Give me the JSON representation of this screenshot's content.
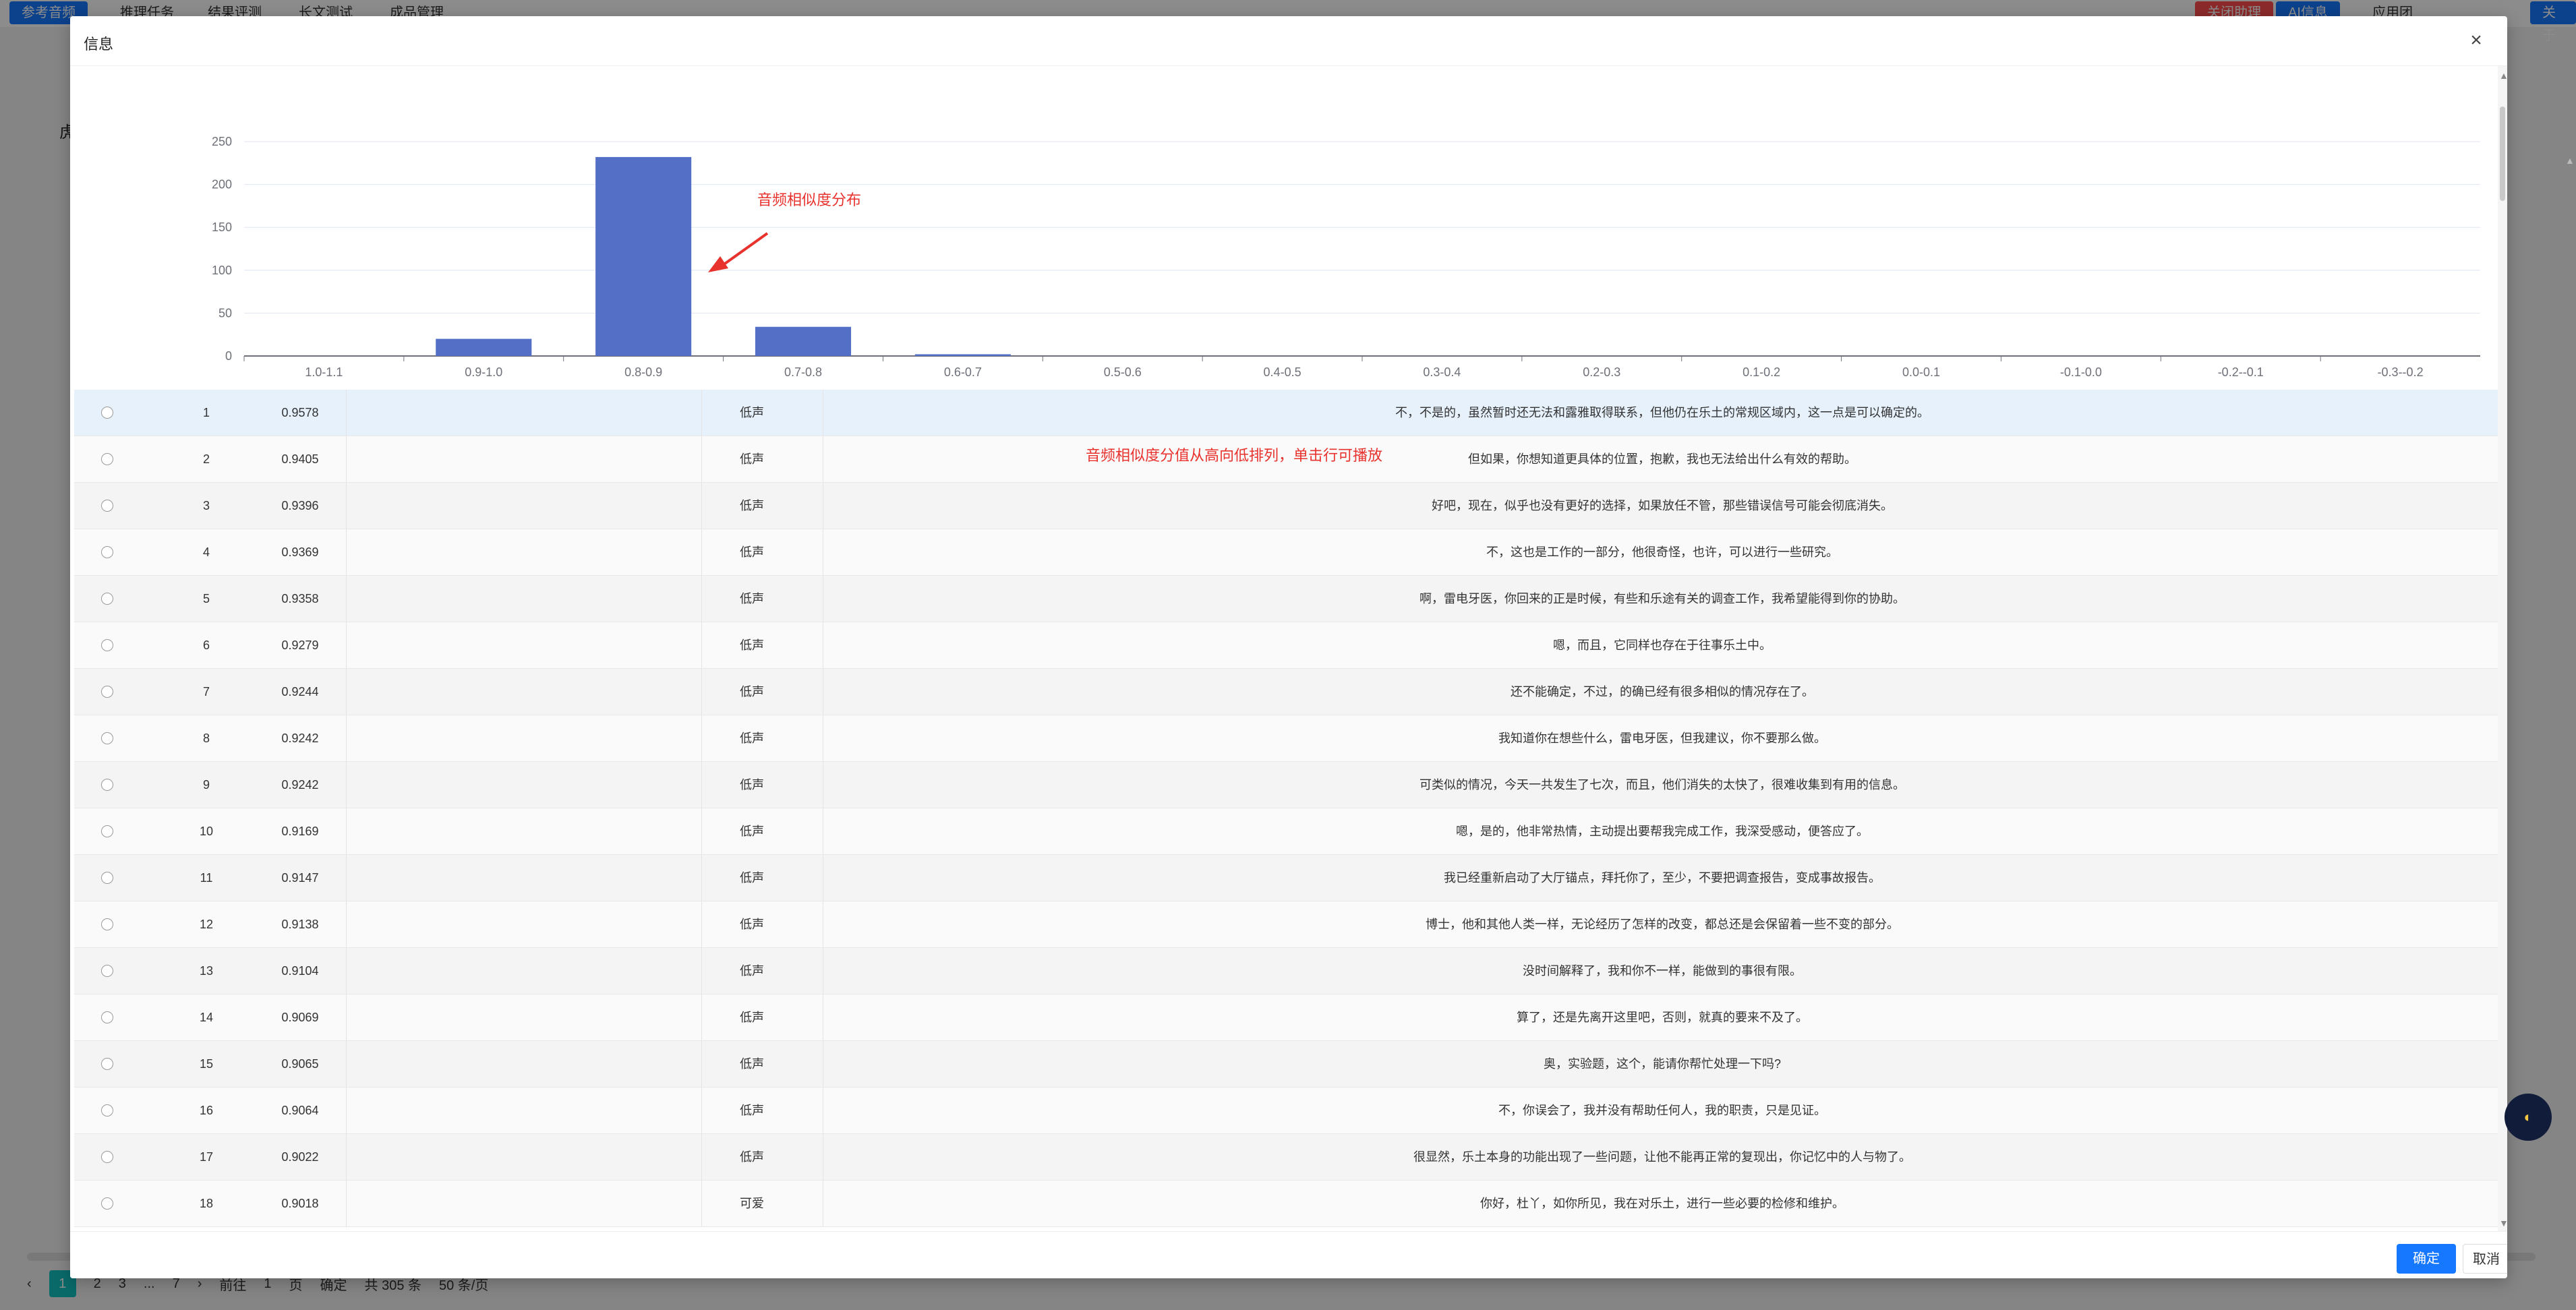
{
  "background": {
    "tabs": [
      "参考音频",
      "推理任务",
      "结果评测",
      "长文测试",
      "成品管理"
    ],
    "right_buttons": [
      "关闭助理",
      "AI信息",
      "应用团"
    ],
    "far_right": "关于",
    "side_heading": "虎",
    "pager": {
      "pages": [
        "1",
        "2",
        "3",
        "...",
        "7"
      ],
      "goto_label": "前往",
      "goto_value": "1",
      "page_suffix": "页",
      "confirm": "确定",
      "total": "共 305 条",
      "page_size": "50 条/页"
    }
  },
  "modal": {
    "title": "信息",
    "close_label": "×",
    "ok_label": "确定",
    "cancel_label": "取消"
  },
  "annotations": {
    "chart": "音频相似度分布",
    "table": "音频相似度分值从高向低排列，单击行可播放"
  },
  "chart_data": {
    "type": "bar",
    "categories": [
      "1.0-1.1",
      "0.9-1.0",
      "0.8-0.9",
      "0.7-0.8",
      "0.6-0.7",
      "0.5-0.6",
      "0.4-0.5",
      "0.3-0.4",
      "0.2-0.3",
      "0.1-0.2",
      "0.0-0.1",
      "-0.1-0.0",
      "-0.2--0.1",
      "-0.3--0.2"
    ],
    "values": [
      0,
      20,
      232,
      34,
      2,
      0,
      0,
      0,
      0,
      0,
      0,
      0,
      0,
      0
    ],
    "yticks": [
      0,
      50,
      100,
      150,
      200,
      250
    ],
    "ylim": [
      0,
      250
    ],
    "grid": true,
    "bar_color": "#5470c6"
  },
  "rows": [
    {
      "idx": "1",
      "score": "0.9578",
      "emotion": "低声",
      "text": "不，不是的，虽然暂时还无法和露雅取得联系，但他仍在乐土的常规区域内，这一点是可以确定的。"
    },
    {
      "idx": "2",
      "score": "0.9405",
      "emotion": "低声",
      "text": "但如果，你想知道更具体的位置，抱歉，我也无法给出什么有效的帮助。"
    },
    {
      "idx": "3",
      "score": "0.9396",
      "emotion": "低声",
      "text": "好吧，现在，似乎也没有更好的选择，如果放任不管，那些错误信号可能会彻底消失。"
    },
    {
      "idx": "4",
      "score": "0.9369",
      "emotion": "低声",
      "text": "不，这也是工作的一部分，他很奇怪，也许，可以进行一些研究。"
    },
    {
      "idx": "5",
      "score": "0.9358",
      "emotion": "低声",
      "text": "啊，雷电牙医，你回来的正是时候，有些和乐途有关的调查工作，我希望能得到你的协助。"
    },
    {
      "idx": "6",
      "score": "0.9279",
      "emotion": "低声",
      "text": "嗯，而且，它同样也存在于往事乐土中。"
    },
    {
      "idx": "7",
      "score": "0.9244",
      "emotion": "低声",
      "text": "还不能确定，不过，的确已经有很多相似的情况存在了。"
    },
    {
      "idx": "8",
      "score": "0.9242",
      "emotion": "低声",
      "text": "我知道你在想些什么，雷电牙医，但我建议，你不要那么做。"
    },
    {
      "idx": "9",
      "score": "0.9242",
      "emotion": "低声",
      "text": "可类似的情况，今天一共发生了七次，而且，他们消失的太快了，很难收集到有用的信息。"
    },
    {
      "idx": "10",
      "score": "0.9169",
      "emotion": "低声",
      "text": "嗯，是的，他非常热情，主动提出要帮我完成工作，我深受感动，便答应了。"
    },
    {
      "idx": "11",
      "score": "0.9147",
      "emotion": "低声",
      "text": "我已经重新启动了大厅锚点，拜托你了，至少，不要把调查报告，变成事故报告。"
    },
    {
      "idx": "12",
      "score": "0.9138",
      "emotion": "低声",
      "text": "博士，他和其他人类一样，无论经历了怎样的改变，都总还是会保留着一些不变的部分。"
    },
    {
      "idx": "13",
      "score": "0.9104",
      "emotion": "低声",
      "text": "没时间解释了，我和你不一样，能做到的事很有限。"
    },
    {
      "idx": "14",
      "score": "0.9069",
      "emotion": "低声",
      "text": "算了，还是先离开这里吧，否则，就真的要来不及了。"
    },
    {
      "idx": "15",
      "score": "0.9065",
      "emotion": "低声",
      "text": "奥，实验题，这个，能请你帮忙处理一下吗?"
    },
    {
      "idx": "16",
      "score": "0.9064",
      "emotion": "低声",
      "text": "不，你误会了，我并没有帮助任何人，我的职责，只是见证。"
    },
    {
      "idx": "17",
      "score": "0.9022",
      "emotion": "低声",
      "text": "很显然，乐土本身的功能出现了一些问题，让他不能再正常的复现出，你记忆中的人与物了。"
    },
    {
      "idx": "18",
      "score": "0.9018",
      "emotion": "可爱",
      "text": "你好，杜丫，如你所见，我在对乐土，进行一些必要的检修和维护。"
    }
  ]
}
